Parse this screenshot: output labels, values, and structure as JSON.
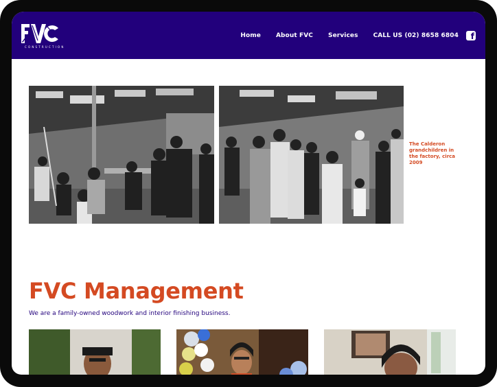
{
  "logo": {
    "text": "FVC",
    "subtitle": "CONSTRUCTION"
  },
  "nav": {
    "items": [
      "Home",
      "About FVC",
      "Services",
      "CALL US (02) 8658 6804"
    ],
    "facebook_icon": "facebook-icon"
  },
  "gallery": {
    "caption": "The Calderon grandchildren in the factory, circa 2009"
  },
  "management": {
    "title": "FVC Management",
    "subtitle": "We are a family-owned woodwork and interior finishing business."
  },
  "colors": {
    "header_bg": "#22007c",
    "accent": "#d44a22",
    "subtitle_text": "#22007c",
    "bezel": "#0a0a0a"
  }
}
